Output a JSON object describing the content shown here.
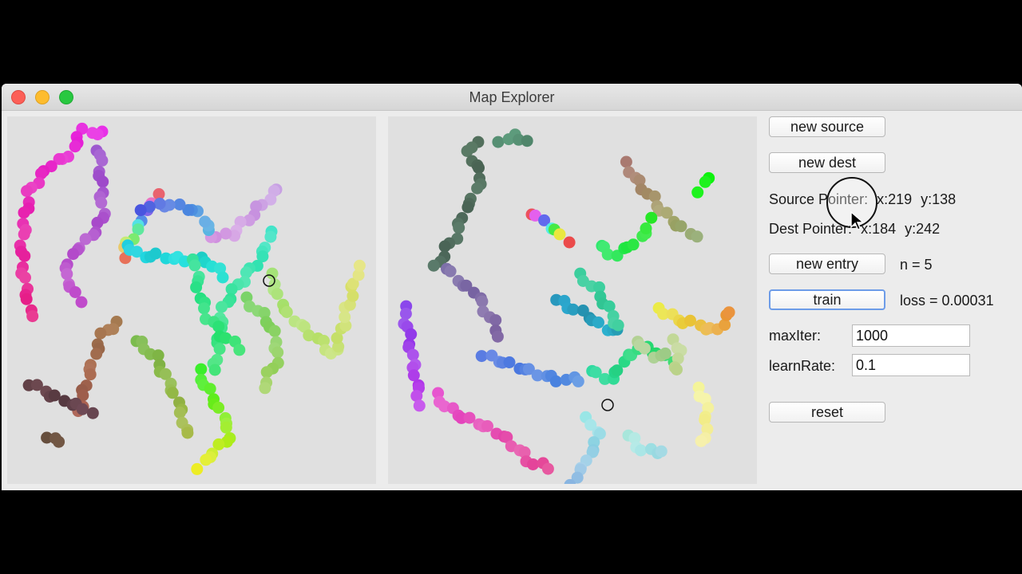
{
  "window": {
    "title": "Map Explorer"
  },
  "buttons": {
    "new_source": "new source",
    "new_dest": "new dest",
    "new_entry": "new entry",
    "train": "train",
    "reset": "reset"
  },
  "status": {
    "source_pointer_label": "Source Pointer:",
    "source_pointer_x": "x:219",
    "source_pointer_y": "y:138",
    "dest_pointer_label": "Dest Pointer:",
    "dest_pointer_x": "x:184",
    "dest_pointer_y": "y:242",
    "n_text": "n = 5",
    "loss_text": "loss = 0.00031"
  },
  "params": {
    "max_iter_label": "maxIter:",
    "max_iter_value": "1000",
    "learn_rate_label": "learnRate:",
    "learn_rate_value": "0.1"
  }
}
